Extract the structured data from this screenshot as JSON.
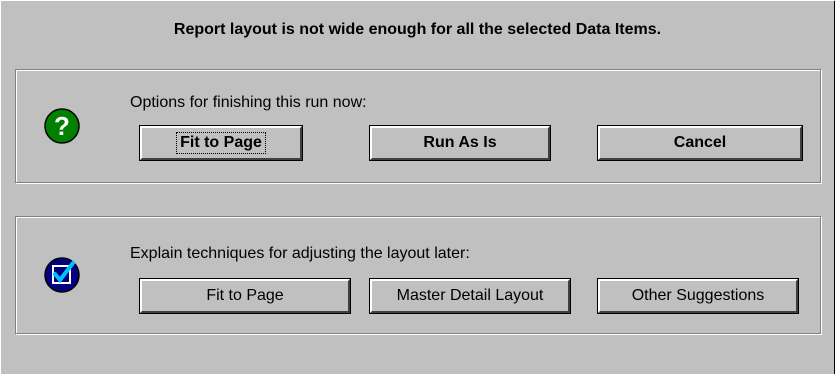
{
  "dialog": {
    "header": "Report layout is not wide enough for all the selected Data Items."
  },
  "finish_now": {
    "label": "Options for finishing this run now:",
    "icon": "question-icon",
    "icon_color": "#008000",
    "buttons": {
      "fit_to_page": "Fit to Page",
      "run_as_is": "Run As Is",
      "cancel": "Cancel"
    }
  },
  "explain_later": {
    "label": "Explain techniques for adjusting the layout later:",
    "icon": "checkbox-icon",
    "icon_color": "#000080",
    "buttons": {
      "fit_to_page": "Fit to Page",
      "master_detail": "Master Detail Layout",
      "other_suggestions": "Other Suggestions"
    }
  }
}
